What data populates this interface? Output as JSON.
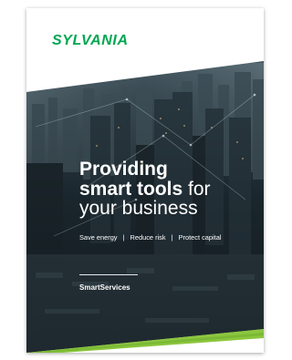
{
  "brochure": {
    "brand": "SYLVANIA",
    "headline": {
      "line1_bold": "Providing",
      "line2_bold": "smart tools",
      "line2_regular": " for",
      "line3": "your business"
    },
    "tagline": {
      "item1": "Save energy",
      "item2": "Reduce risk",
      "item3": "Protect capital",
      "separator": "|"
    },
    "product_name": "SmartServices"
  },
  "colors": {
    "brand_green": "#00a651",
    "accent_lime": "#8cc63f",
    "photo_dark": "#1d2b33"
  }
}
